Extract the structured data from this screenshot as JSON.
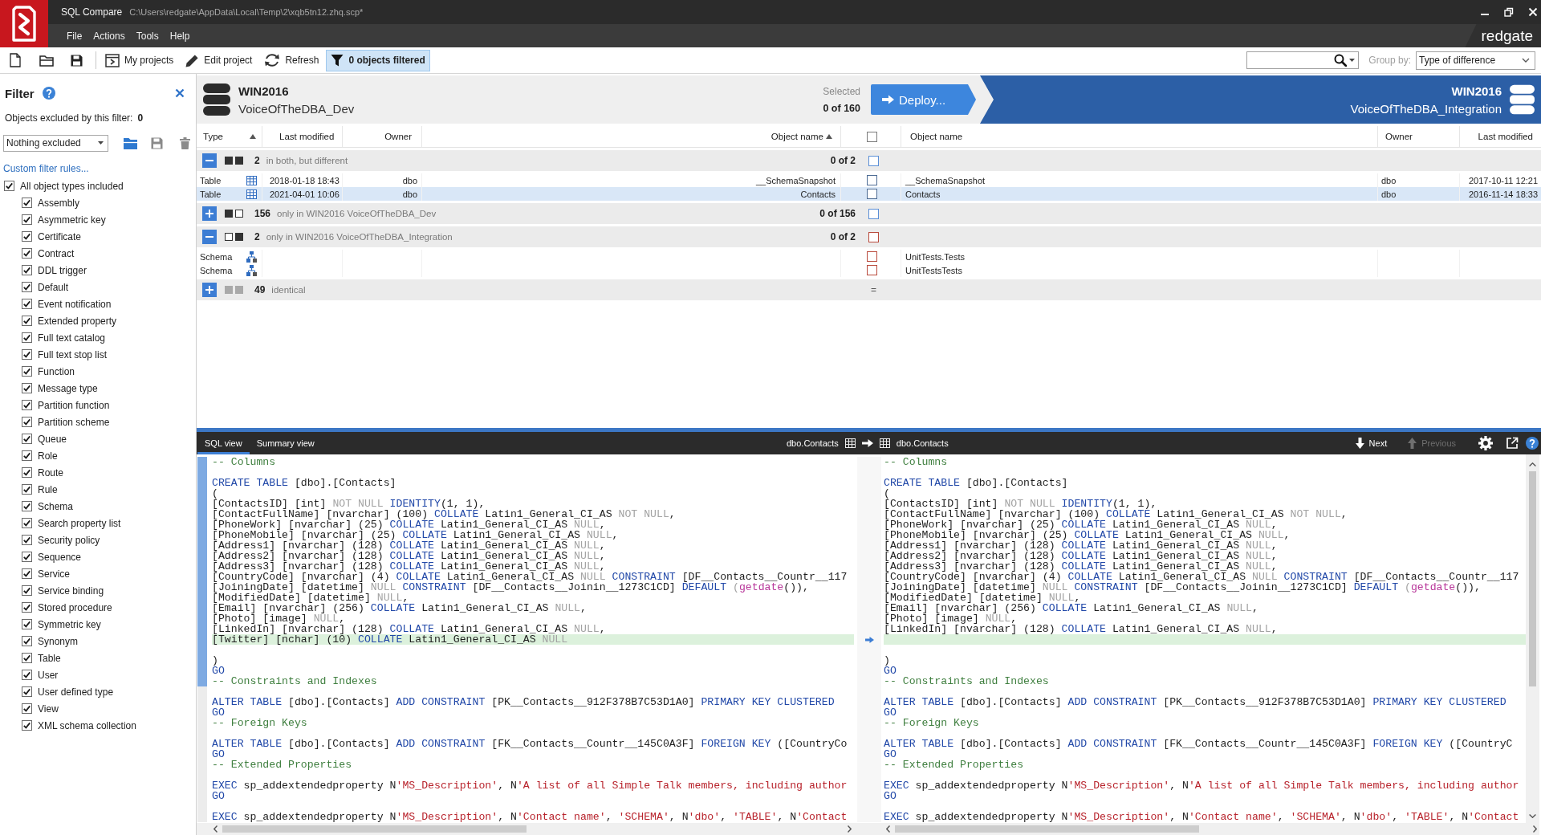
{
  "window": {
    "app_name": "SQL Compare",
    "file_path": "C:\\Users\\redgate\\AppData\\Local\\Temp\\2\\xqb5tn12.zhq.scp*",
    "brand": "redgate"
  },
  "menu": [
    {
      "label": "File"
    },
    {
      "label": "Actions"
    },
    {
      "label": "Tools"
    },
    {
      "label": "Help"
    }
  ],
  "toolbar": {
    "buttons": [
      {
        "kind": "projects",
        "label": "My projects",
        "selected": false
      },
      {
        "kind": "edit",
        "label": "Edit project",
        "selected": false
      },
      {
        "kind": "refresh",
        "label": "Refresh",
        "selected": false
      },
      {
        "kind": "filter",
        "label": "0 objects filtered",
        "selected": true
      }
    ],
    "group_by": {
      "label": "Group by:",
      "value": "Type of difference"
    }
  },
  "filter_panel": {
    "title": "Filter",
    "excluded_label": "Objects excluded by this filter:",
    "excluded_count": "0",
    "preset": "Nothing excluded",
    "custom_rules_link": "Custom filter rules...",
    "object_types": [
      {
        "label": "All object types included",
        "checked": true,
        "children": [
          {
            "label": "Assembly",
            "checked": true
          },
          {
            "label": "Asymmetric key",
            "checked": true
          },
          {
            "label": "Certificate",
            "checked": true
          },
          {
            "label": "Contract",
            "checked": true
          },
          {
            "label": "DDL trigger",
            "checked": true
          },
          {
            "label": "Default",
            "checked": true
          },
          {
            "label": "Event notification",
            "checked": true
          },
          {
            "label": "Extended property",
            "checked": true
          },
          {
            "label": "Full text catalog",
            "checked": true
          },
          {
            "label": "Full text stop list",
            "checked": true
          },
          {
            "label": "Function",
            "checked": true
          },
          {
            "label": "Message type",
            "checked": true
          },
          {
            "label": "Partition function",
            "checked": true
          },
          {
            "label": "Partition scheme",
            "checked": true
          },
          {
            "label": "Queue",
            "checked": true
          },
          {
            "label": "Role",
            "checked": true
          },
          {
            "label": "Route",
            "checked": true
          },
          {
            "label": "Rule",
            "checked": true
          },
          {
            "label": "Schema",
            "checked": true
          },
          {
            "label": "Search property list",
            "checked": true
          },
          {
            "label": "Security policy",
            "checked": true
          },
          {
            "label": "Sequence",
            "checked": true
          },
          {
            "label": "Service",
            "checked": true
          },
          {
            "label": "Service binding",
            "checked": true
          },
          {
            "label": "Stored procedure",
            "checked": true
          },
          {
            "label": "Symmetric key",
            "checked": true
          },
          {
            "label": "Synonym",
            "checked": true
          },
          {
            "label": "Table",
            "checked": true
          },
          {
            "label": "User",
            "checked": true
          },
          {
            "label": "User defined type",
            "checked": true
          },
          {
            "label": "View",
            "checked": true
          },
          {
            "label": "XML schema collection",
            "checked": true
          }
        ]
      }
    ]
  },
  "comparison": {
    "left": {
      "server": "WIN2016",
      "database": "VoiceOfTheDBA_Dev"
    },
    "selected_label": "Selected",
    "selected_count": "0 of 160",
    "deploy_label": "Deploy...",
    "right": {
      "server": "WIN2016",
      "database": "VoiceOfTheDBA_Integration"
    }
  },
  "results": {
    "columns_left": [
      {
        "label": "Type",
        "sorted": true
      },
      {
        "label": "Last modified",
        "sorted": false
      },
      {
        "label": "Owner",
        "sorted": false
      },
      {
        "label": "Object name",
        "sorted": true
      }
    ],
    "select_all": {
      "checked": false
    },
    "columns_right": [
      {
        "label": "Object name",
        "sorted": false
      },
      {
        "label": "Owner",
        "sorted": false
      },
      {
        "label": "Last modified",
        "sorted": false
      }
    ],
    "groups": [
      {
        "kind": "different",
        "expanded": true,
        "count": "2",
        "label": "in both, but different",
        "selection": "0 of 2",
        "checked": false,
        "rows": [
          {
            "kind": "table",
            "type": "Table",
            "left_modified": "2018-01-18 18:43",
            "left_owner": "dbo",
            "left_name": "__SchemaSnapshot",
            "checked": false,
            "right_name": "__SchemaSnapshot",
            "right_owner": "dbo",
            "right_modified": "2017-10-11 12:21",
            "selected": false
          },
          {
            "kind": "table",
            "type": "Table",
            "left_modified": "2021-04-01 10:06",
            "left_owner": "dbo",
            "left_name": "Contacts",
            "checked": false,
            "right_name": "Contacts",
            "right_owner": "dbo",
            "right_modified": "2016-11-14 18:33",
            "selected": true
          }
        ]
      },
      {
        "kind": "only_left",
        "expanded": false,
        "count": "156",
        "label": "only in WIN2016 VoiceOfTheDBA_Dev",
        "selection": "0 of 156",
        "checked": false
      },
      {
        "kind": "only_right",
        "expanded": true,
        "count": "2",
        "label": "only in WIN2016 VoiceOfTheDBA_Integration",
        "selection": "0 of 2",
        "checked": false,
        "rows": [
          {
            "kind": "schema",
            "type": "Schema",
            "checked": false,
            "right_name": "UnitTests.Tests",
            "selected": false
          },
          {
            "kind": "schema",
            "type": "Schema",
            "checked": false,
            "right_name": "UnitTestsTests",
            "selected": false
          }
        ]
      },
      {
        "kind": "identical",
        "expanded": false,
        "count": "49",
        "label": "identical",
        "status_mark": "="
      }
    ]
  },
  "diff_view": {
    "tabs": [
      {
        "label": "SQL view",
        "selected": true
      },
      {
        "label": "Summary view",
        "selected": false
      }
    ],
    "left_object": "dbo.Contacts",
    "right_object": "dbo.Contacts",
    "navigation": [
      {
        "kind": "next",
        "label": "Next",
        "disabled": false
      },
      {
        "kind": "previous",
        "label": "Previous",
        "disabled": true
      }
    ],
    "left_pane": {
      "blocks": [
        {
          "marked": true,
          "lines": [
            {
              "changed": false,
              "tokens": [
                {
                  "kind": "comment",
                  "text": "-- Columns"
                }
              ]
            },
            {
              "changed": false
            },
            {
              "changed": false,
              "tokens": [
                {
                  "kind": "keyword",
                  "text": "CREATE TABLE"
                },
                {
                  "kind": "plain",
                  "text": " [dbo].[Contacts]"
                }
              ]
            },
            {
              "changed": false,
              "tokens": [
                {
                  "kind": "plain",
                  "text": "("
                }
              ]
            },
            {
              "changed": false,
              "tokens": [
                {
                  "kind": "plain",
                  "text": "[ContactsID] [int] "
                },
                {
                  "kind": "null",
                  "text": "NOT NULL "
                },
                {
                  "kind": "keyword",
                  "text": "IDENTITY"
                },
                {
                  "kind": "plain",
                  "text": "(1, 1),"
                }
              ]
            },
            {
              "changed": false,
              "tokens": [
                {
                  "kind": "plain",
                  "text": "[ContactFullName] [nvarchar] (100) "
                },
                {
                  "kind": "keyword",
                  "text": "COLLATE"
                },
                {
                  "kind": "plain",
                  "text": " Latin1_General_CI_AS "
                },
                {
                  "kind": "null",
                  "text": "NOT NULL"
                },
                {
                  "kind": "plain",
                  "text": ","
                }
              ]
            },
            {
              "changed": false,
              "tokens": [
                {
                  "kind": "plain",
                  "text": "[PhoneWork] [nvarchar] (25) "
                },
                {
                  "kind": "keyword",
                  "text": "COLLATE"
                },
                {
                  "kind": "plain",
                  "text": " Latin1_General_CI_AS "
                },
                {
                  "kind": "null",
                  "text": "NULL"
                },
                {
                  "kind": "plain",
                  "text": ","
                }
              ]
            },
            {
              "changed": false,
              "tokens": [
                {
                  "kind": "plain",
                  "text": "[PhoneMobile] [nvarchar] (25) "
                },
                {
                  "kind": "keyword",
                  "text": "COLLATE"
                },
                {
                  "kind": "plain",
                  "text": " Latin1_General_CI_AS "
                },
                {
                  "kind": "null",
                  "text": "NULL"
                },
                {
                  "kind": "plain",
                  "text": ","
                }
              ]
            },
            {
              "changed": false,
              "tokens": [
                {
                  "kind": "plain",
                  "text": "[Address1] [nvarchar] (128) "
                },
                {
                  "kind": "keyword",
                  "text": "COLLATE"
                },
                {
                  "kind": "plain",
                  "text": " Latin1_General_CI_AS "
                },
                {
                  "kind": "null",
                  "text": "NULL"
                },
                {
                  "kind": "plain",
                  "text": ","
                }
              ]
            },
            {
              "changed": false,
              "tokens": [
                {
                  "kind": "plain",
                  "text": "[Address2] [nvarchar] (128) "
                },
                {
                  "kind": "keyword",
                  "text": "COLLATE"
                },
                {
                  "kind": "plain",
                  "text": " Latin1_General_CI_AS "
                },
                {
                  "kind": "null",
                  "text": "NULL"
                },
                {
                  "kind": "plain",
                  "text": ","
                }
              ]
            },
            {
              "changed": false,
              "tokens": [
                {
                  "kind": "plain",
                  "text": "[Address3] [nvarchar] (128) "
                },
                {
                  "kind": "keyword",
                  "text": "COLLATE"
                },
                {
                  "kind": "plain",
                  "text": " Latin1_General_CI_AS "
                },
                {
                  "kind": "null",
                  "text": "NULL"
                },
                {
                  "kind": "plain",
                  "text": ","
                }
              ]
            },
            {
              "changed": false,
              "tokens": [
                {
                  "kind": "plain",
                  "text": "[CountryCode] [nvarchar] (4) "
                },
                {
                  "kind": "keyword",
                  "text": "COLLATE"
                },
                {
                  "kind": "plain",
                  "text": " Latin1_General_CI_AS "
                },
                {
                  "kind": "null",
                  "text": "NULL "
                },
                {
                  "kind": "keyword",
                  "text": "CONSTRAINT"
                },
                {
                  "kind": "plain",
                  "text": " [DF__Contacts__Countr__117"
                }
              ]
            },
            {
              "changed": false,
              "tokens": [
                {
                  "kind": "plain",
                  "text": "[JoiningDate] [datetime] "
                },
                {
                  "kind": "null",
                  "text": "NULL "
                },
                {
                  "kind": "keyword",
                  "text": "CONSTRAINT"
                },
                {
                  "kind": "plain",
                  "text": " [DF__Contacts__Joinin__1273C1CD] "
                },
                {
                  "kind": "keyword",
                  "text": "DEFAULT "
                },
                {
                  "kind": "null",
                  "text": "("
                },
                {
                  "kind": "function",
                  "text": "getdate"
                },
                {
                  "kind": "plain",
                  "text": "()),"
                }
              ]
            },
            {
              "changed": false,
              "tokens": [
                {
                  "kind": "plain",
                  "text": "[ModifiedDate] [datetime] "
                },
                {
                  "kind": "null",
                  "text": "NULL"
                },
                {
                  "kind": "plain",
                  "text": ","
                }
              ]
            },
            {
              "changed": false,
              "tokens": [
                {
                  "kind": "plain",
                  "text": "[Email] [nvarchar] (256) "
                },
                {
                  "kind": "keyword",
                  "text": "COLLATE"
                },
                {
                  "kind": "plain",
                  "text": " Latin1_General_CI_AS "
                },
                {
                  "kind": "null",
                  "text": "NULL"
                },
                {
                  "kind": "plain",
                  "text": ","
                }
              ]
            },
            {
              "changed": false,
              "tokens": [
                {
                  "kind": "plain",
                  "text": "[Photo] [image] "
                },
                {
                  "kind": "null",
                  "text": "NULL"
                },
                {
                  "kind": "plain",
                  "text": ","
                }
              ]
            },
            {
              "changed": false,
              "tokens": [
                {
                  "kind": "plain",
                  "text": "[LinkedIn] [nvarchar] (128) "
                },
                {
                  "kind": "keyword",
                  "text": "COLLATE"
                },
                {
                  "kind": "plain",
                  "text": " Latin1_General_CI_AS "
                },
                {
                  "kind": "null",
                  "text": "NULL"
                },
                {
                  "kind": "plain",
                  "text": ","
                }
              ]
            },
            {
              "changed": true,
              "tokens": [
                {
                  "kind": "plain",
                  "text": "[Twitter] [nchar] (10) "
                },
                {
                  "kind": "keyword",
                  "text": "COLLATE"
                },
                {
                  "kind": "plain",
                  "text": " Latin1_General_CI_AS "
                },
                {
                  "kind": "null",
                  "text": "NULL"
                }
              ]
            },
            {
              "changed": false
            },
            {
              "changed": false,
              "tokens": [
                {
                  "kind": "plain",
                  "text": ")"
                }
              ]
            },
            {
              "changed": false,
              "tokens": [
                {
                  "kind": "keyword",
                  "text": "GO"
                }
              ]
            },
            {
              "changed": false,
              "tokens": [
                {
                  "kind": "comment",
                  "text": "-- Constraints and Indexes"
                }
              ]
            }
          ]
        },
        {
          "marked": false,
          "lines": [
            {
              "changed": false
            },
            {
              "changed": false,
              "tokens": [
                {
                  "kind": "keyword",
                  "text": "ALTER TABLE"
                },
                {
                  "kind": "plain",
                  "text": " [dbo].[Contacts] "
                },
                {
                  "kind": "keyword",
                  "text": "ADD CONSTRAINT"
                },
                {
                  "kind": "plain",
                  "text": " [PK__Contacts__912F378B7C53D1A0] "
                },
                {
                  "kind": "keyword",
                  "text": "PRIMARY KEY CLUSTERED"
                }
              ]
            },
            {
              "changed": false,
              "tokens": [
                {
                  "kind": "keyword",
                  "text": "GO"
                }
              ]
            },
            {
              "changed": false,
              "tokens": [
                {
                  "kind": "comment",
                  "text": "-- Foreign Keys"
                }
              ]
            },
            {
              "changed": false
            },
            {
              "changed": false,
              "tokens": [
                {
                  "kind": "keyword",
                  "text": "ALTER TABLE"
                },
                {
                  "kind": "plain",
                  "text": " [dbo].[Contacts] "
                },
                {
                  "kind": "keyword",
                  "text": "ADD CONSTRAINT"
                },
                {
                  "kind": "plain",
                  "text": " [FK__Contacts__Countr__145C0A3F] "
                },
                {
                  "kind": "keyword",
                  "text": "FOREIGN KEY"
                },
                {
                  "kind": "plain",
                  "text": " ([CountryCo"
                }
              ]
            },
            {
              "changed": false,
              "tokens": [
                {
                  "kind": "keyword",
                  "text": "GO"
                }
              ]
            },
            {
              "changed": false,
              "tokens": [
                {
                  "kind": "comment",
                  "text": "-- Extended Properties"
                }
              ]
            },
            {
              "changed": false
            },
            {
              "changed": false,
              "tokens": [
                {
                  "kind": "keyword",
                  "text": "EXEC"
                },
                {
                  "kind": "plain",
                  "text": " sp_addextendedproperty N"
                },
                {
                  "kind": "string",
                  "text": "'MS_Description'"
                },
                {
                  "kind": "plain",
                  "text": ", N"
                },
                {
                  "kind": "string",
                  "text": "'A list of all Simple Talk members, including author"
                }
              ]
            },
            {
              "changed": false,
              "tokens": [
                {
                  "kind": "keyword",
                  "text": "GO"
                }
              ]
            },
            {
              "changed": false
            },
            {
              "changed": false,
              "tokens": [
                {
                  "kind": "keyword",
                  "text": "EXEC"
                },
                {
                  "kind": "plain",
                  "text": " sp_addextendedproperty N"
                },
                {
                  "kind": "string",
                  "text": "'MS_Description'"
                },
                {
                  "kind": "plain",
                  "text": ", N"
                },
                {
                  "kind": "string",
                  "text": "'Contact name'"
                },
                {
                  "kind": "plain",
                  "text": ", "
                },
                {
                  "kind": "string",
                  "text": "'SCHEMA'"
                },
                {
                  "kind": "plain",
                  "text": ", N"
                },
                {
                  "kind": "string",
                  "text": "'dbo'"
                },
                {
                  "kind": "plain",
                  "text": ", "
                },
                {
                  "kind": "string",
                  "text": "'TABLE'"
                },
                {
                  "kind": "plain",
                  "text": ", N"
                },
                {
                  "kind": "string",
                  "text": "'Contact"
                }
              ]
            }
          ]
        }
      ]
    },
    "right_pane": {
      "blocks": [
        {
          "marked": false,
          "lines": [
            {
              "changed": false,
              "tokens": [
                {
                  "kind": "comment",
                  "text": "-- Columns"
                }
              ]
            },
            {
              "changed": false
            },
            {
              "changed": false,
              "tokens": [
                {
                  "kind": "keyword",
                  "text": "CREATE TABLE"
                },
                {
                  "kind": "plain",
                  "text": " [dbo].[Contacts]"
                }
              ]
            },
            {
              "changed": false,
              "tokens": [
                {
                  "kind": "plain",
                  "text": "("
                }
              ]
            },
            {
              "changed": false,
              "tokens": [
                {
                  "kind": "plain",
                  "text": "[ContactsID] [int] "
                },
                {
                  "kind": "null",
                  "text": "NOT NULL "
                },
                {
                  "kind": "keyword",
                  "text": "IDENTITY"
                },
                {
                  "kind": "plain",
                  "text": "(1, 1),"
                }
              ]
            },
            {
              "changed": false,
              "tokens": [
                {
                  "kind": "plain",
                  "text": "[ContactFullName] [nvarchar] (100) "
                },
                {
                  "kind": "keyword",
                  "text": "COLLATE"
                },
                {
                  "kind": "plain",
                  "text": " Latin1_General_CI_AS "
                },
                {
                  "kind": "null",
                  "text": "NOT NULL"
                },
                {
                  "kind": "plain",
                  "text": ","
                }
              ]
            },
            {
              "changed": false,
              "tokens": [
                {
                  "kind": "plain",
                  "text": "[PhoneWork] [nvarchar] (25) "
                },
                {
                  "kind": "keyword",
                  "text": "COLLATE"
                },
                {
                  "kind": "plain",
                  "text": " Latin1_General_CI_AS "
                },
                {
                  "kind": "null",
                  "text": "NULL"
                },
                {
                  "kind": "plain",
                  "text": ","
                }
              ]
            },
            {
              "changed": false,
              "tokens": [
                {
                  "kind": "plain",
                  "text": "[PhoneMobile] [nvarchar] (25) "
                },
                {
                  "kind": "keyword",
                  "text": "COLLATE"
                },
                {
                  "kind": "plain",
                  "text": " Latin1_General_CI_AS "
                },
                {
                  "kind": "null",
                  "text": "NULL"
                },
                {
                  "kind": "plain",
                  "text": ","
                }
              ]
            },
            {
              "changed": false,
              "tokens": [
                {
                  "kind": "plain",
                  "text": "[Address1] [nvarchar] (128) "
                },
                {
                  "kind": "keyword",
                  "text": "COLLATE"
                },
                {
                  "kind": "plain",
                  "text": " Latin1_General_CI_AS "
                },
                {
                  "kind": "null",
                  "text": "NULL"
                },
                {
                  "kind": "plain",
                  "text": ","
                }
              ]
            },
            {
              "changed": false,
              "tokens": [
                {
                  "kind": "plain",
                  "text": "[Address2] [nvarchar] (128) "
                },
                {
                  "kind": "keyword",
                  "text": "COLLATE"
                },
                {
                  "kind": "plain",
                  "text": " Latin1_General_CI_AS "
                },
                {
                  "kind": "null",
                  "text": "NULL"
                },
                {
                  "kind": "plain",
                  "text": ","
                }
              ]
            },
            {
              "changed": false,
              "tokens": [
                {
                  "kind": "plain",
                  "text": "[Address3] [nvarchar] (128) "
                },
                {
                  "kind": "keyword",
                  "text": "COLLATE"
                },
                {
                  "kind": "plain",
                  "text": " Latin1_General_CI_AS "
                },
                {
                  "kind": "null",
                  "text": "NULL"
                },
                {
                  "kind": "plain",
                  "text": ","
                }
              ]
            },
            {
              "changed": false,
              "tokens": [
                {
                  "kind": "plain",
                  "text": "[CountryCode] [nvarchar] (4) "
                },
                {
                  "kind": "keyword",
                  "text": "COLLATE"
                },
                {
                  "kind": "plain",
                  "text": " Latin1_General_CI_AS "
                },
                {
                  "kind": "null",
                  "text": "NULL "
                },
                {
                  "kind": "keyword",
                  "text": "CONSTRAINT"
                },
                {
                  "kind": "plain",
                  "text": " [DF__Contacts__Countr__117"
                }
              ]
            },
            {
              "changed": false,
              "tokens": [
                {
                  "kind": "plain",
                  "text": "[JoiningDate] [datetime] "
                },
                {
                  "kind": "null",
                  "text": "NULL "
                },
                {
                  "kind": "keyword",
                  "text": "CONSTRAINT"
                },
                {
                  "kind": "plain",
                  "text": " [DF__Contacts__Joinin__1273C1CD] "
                },
                {
                  "kind": "keyword",
                  "text": "DEFAULT "
                },
                {
                  "kind": "null",
                  "text": "("
                },
                {
                  "kind": "function",
                  "text": "getdate"
                },
                {
                  "kind": "plain",
                  "text": "()),"
                }
              ]
            },
            {
              "changed": false,
              "tokens": [
                {
                  "kind": "plain",
                  "text": "[ModifiedDate] [datetime] "
                },
                {
                  "kind": "null",
                  "text": "NULL"
                },
                {
                  "kind": "plain",
                  "text": ","
                }
              ]
            },
            {
              "changed": false,
              "tokens": [
                {
                  "kind": "plain",
                  "text": "[Email] [nvarchar] (256) "
                },
                {
                  "kind": "keyword",
                  "text": "COLLATE"
                },
                {
                  "kind": "plain",
                  "text": " Latin1_General_CI_AS "
                },
                {
                  "kind": "null",
                  "text": "NULL"
                },
                {
                  "kind": "plain",
                  "text": ","
                }
              ]
            },
            {
              "changed": false,
              "tokens": [
                {
                  "kind": "plain",
                  "text": "[Photo] [image] "
                },
                {
                  "kind": "null",
                  "text": "NULL"
                },
                {
                  "kind": "plain",
                  "text": ","
                }
              ]
            },
            {
              "changed": false,
              "tokens": [
                {
                  "kind": "plain",
                  "text": "[LinkedIn] [nvarchar] (128) "
                },
                {
                  "kind": "keyword",
                  "text": "COLLATE"
                },
                {
                  "kind": "plain",
                  "text": " Latin1_General_CI_AS "
                },
                {
                  "kind": "null",
                  "text": "NULL"
                },
                {
                  "kind": "plain",
                  "text": ","
                }
              ]
            },
            {
              "changed": true
            },
            {
              "changed": false
            },
            {
              "changed": false,
              "tokens": [
                {
                  "kind": "plain",
                  "text": ")"
                }
              ]
            },
            {
              "changed": false,
              "tokens": [
                {
                  "kind": "keyword",
                  "text": "GO"
                }
              ]
            },
            {
              "changed": false,
              "tokens": [
                {
                  "kind": "comment",
                  "text": "-- Constraints and Indexes"
                }
              ]
            }
          ]
        },
        {
          "marked": false,
          "lines": [
            {
              "changed": false
            },
            {
              "changed": false,
              "tokens": [
                {
                  "kind": "keyword",
                  "text": "ALTER TABLE"
                },
                {
                  "kind": "plain",
                  "text": " [dbo].[Contacts] "
                },
                {
                  "kind": "keyword",
                  "text": "ADD CONSTRAINT"
                },
                {
                  "kind": "plain",
                  "text": " [PK__Contacts__912F378B7C53D1A0] "
                },
                {
                  "kind": "keyword",
                  "text": "PRIMARY KEY CLUSTERED"
                }
              ]
            },
            {
              "changed": false,
              "tokens": [
                {
                  "kind": "keyword",
                  "text": "GO"
                }
              ]
            },
            {
              "changed": false,
              "tokens": [
                {
                  "kind": "comment",
                  "text": "-- Foreign Keys"
                }
              ]
            },
            {
              "changed": false
            },
            {
              "changed": false,
              "tokens": [
                {
                  "kind": "keyword",
                  "text": "ALTER TABLE"
                },
                {
                  "kind": "plain",
                  "text": " [dbo].[Contacts] "
                },
                {
                  "kind": "keyword",
                  "text": "ADD CONSTRAINT"
                },
                {
                  "kind": "plain",
                  "text": " [FK__Contacts__Countr__145C0A3F] "
                },
                {
                  "kind": "keyword",
                  "text": "FOREIGN KEY"
                },
                {
                  "kind": "plain",
                  "text": " ([CountryC"
                }
              ]
            },
            {
              "changed": false,
              "tokens": [
                {
                  "kind": "keyword",
                  "text": "GO"
                }
              ]
            },
            {
              "changed": false,
              "tokens": [
                {
                  "kind": "comment",
                  "text": "-- Extended Properties"
                }
              ]
            },
            {
              "changed": false
            },
            {
              "changed": false,
              "tokens": [
                {
                  "kind": "keyword",
                  "text": "EXEC"
                },
                {
                  "kind": "plain",
                  "text": " sp_addextendedproperty N"
                },
                {
                  "kind": "string",
                  "text": "'MS_Description'"
                },
                {
                  "kind": "plain",
                  "text": ", N"
                },
                {
                  "kind": "string",
                  "text": "'A list of all Simple Talk members, including author"
                }
              ]
            },
            {
              "changed": false,
              "tokens": [
                {
                  "kind": "keyword",
                  "text": "GO"
                }
              ]
            },
            {
              "changed": false
            },
            {
              "changed": false,
              "tokens": [
                {
                  "kind": "keyword",
                  "text": "EXEC"
                },
                {
                  "kind": "plain",
                  "text": " sp_addextendedproperty N"
                },
                {
                  "kind": "string",
                  "text": "'MS_Description'"
                },
                {
                  "kind": "plain",
                  "text": ", N"
                },
                {
                  "kind": "string",
                  "text": "'Contact name'"
                },
                {
                  "kind": "plain",
                  "text": ", "
                },
                {
                  "kind": "string",
                  "text": "'SCHEMA'"
                },
                {
                  "kind": "plain",
                  "text": ", N"
                },
                {
                  "kind": "string",
                  "text": "'dbo'"
                },
                {
                  "kind": "plain",
                  "text": ", "
                },
                {
                  "kind": "string",
                  "text": "'TABLE'"
                },
                {
                  "kind": "plain",
                  "text": ", N"
                },
                {
                  "kind": "string",
                  "text": "'Contact"
                }
              ]
            }
          ]
        }
      ]
    }
  }
}
